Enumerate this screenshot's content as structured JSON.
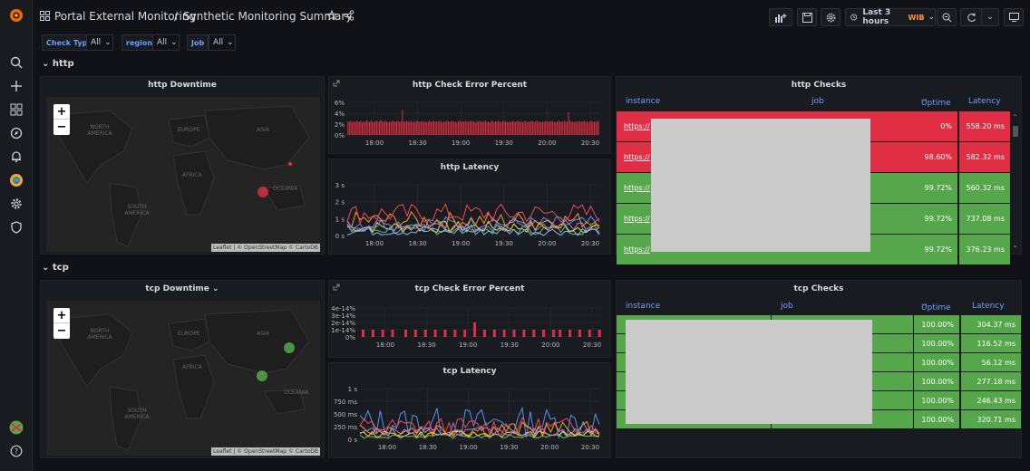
{
  "breadcrumb": {
    "folder": "Portal External Monitoring",
    "separator": "/",
    "dashboard": "Synthetic Monitoring Summary"
  },
  "time_picker": {
    "range": "Last 3 hours",
    "timezone": "WIB"
  },
  "variables": [
    {
      "label": "Check Type",
      "value": "All"
    },
    {
      "label": "region",
      "value": "All"
    },
    {
      "label": "Job",
      "value": "All"
    }
  ],
  "rows": {
    "http": "http",
    "tcp": "tcp"
  },
  "map_labels": {
    "north_america": "NORTH AMERICA",
    "south_america": "SOUTH AMERICA",
    "europe": "EUROPE",
    "africa": "AFRICA",
    "asia": "ASIA",
    "oceania": "OCEANIA",
    "zoom_in": "+",
    "zoom_out": "−",
    "attribution": "Leaflet | © OpenStreetMap © CartoDB"
  },
  "panels": {
    "http_downtime": {
      "title": "http Downtime"
    },
    "http_error": {
      "title": "http Check Error Percent"
    },
    "http_latency": {
      "title": "http Latency"
    },
    "http_checks": {
      "title": "http Checks"
    },
    "tcp_downtime": {
      "title": "tcp Downtime"
    },
    "tcp_error": {
      "title": "tcp Check Error Percent"
    },
    "tcp_latency": {
      "title": "tcp Latency"
    },
    "tcp_checks": {
      "title": "tcp Checks"
    }
  },
  "http_table": {
    "columns": [
      "instance",
      "job",
      "Uptime",
      "Latency"
    ],
    "rows": [
      {
        "instance": "https://",
        "uptime": "0%",
        "latency": "558.20 ms",
        "status": "down"
      },
      {
        "instance": "https://",
        "uptime": "98.60%",
        "latency": "582.32 ms",
        "status": "down"
      },
      {
        "instance": "https://",
        "uptime": "99.72%",
        "latency": "560.32 ms",
        "status": "up"
      },
      {
        "instance": "https://",
        "uptime": "99.72%",
        "latency": "737.08 ms",
        "status": "up"
      },
      {
        "instance": "https://",
        "uptime": "99.72%",
        "latency": "376.23 ms",
        "status": "up"
      }
    ]
  },
  "tcp_table": {
    "columns": [
      "instance",
      "job",
      "Uptime",
      "Latency"
    ],
    "rows": [
      {
        "uptime": "100.00%",
        "latency": "304.37 ms"
      },
      {
        "uptime": "100.00%",
        "latency": "116.52 ms"
      },
      {
        "uptime": "100.00%",
        "latency": "56.12 ms"
      },
      {
        "uptime": "100.00%",
        "latency": "277.18 ms"
      },
      {
        "uptime": "100.00%",
        "latency": "246.43 ms"
      },
      {
        "uptime": "100.00%",
        "latency": "320.71 ms"
      }
    ]
  },
  "colors": {
    "red": "#e02f44",
    "green": "#56a64b",
    "bg": "#111217",
    "panel": "#181b1f",
    "blue": "#6e9fff"
  },
  "chart_data": [
    {
      "type": "bar",
      "title": "http Check Error Percent",
      "y_ticks": [
        "6%",
        "4%",
        "2%",
        "0%"
      ],
      "ylim": [
        0,
        6
      ],
      "x_ticks": [
        "18:00",
        "18:30",
        "19:00",
        "19:30",
        "20:00",
        "20:30"
      ],
      "values": [
        2.5,
        2.4,
        2.6,
        2.3,
        2.5,
        2.4,
        2.6,
        2.5,
        2.4,
        2.6,
        2.3,
        2.5,
        2.4,
        2.7,
        2.5,
        2.4,
        2.6,
        2.5,
        2.3,
        2.5,
        2.6,
        2.4,
        2.5,
        2.8,
        2.5,
        2.4,
        2.6,
        2.5,
        2.3,
        2.5,
        2.4,
        2.6,
        2.5,
        2.4,
        2.5,
        2.6,
        2.4,
        2.5,
        4.6,
        2.5,
        2.4,
        2.6,
        2.5,
        2.4,
        2.6,
        2.3,
        2.5,
        2.4,
        2.6,
        2.5,
        2.4,
        2.5,
        2.6,
        2.4,
        2.5,
        2.3,
        2.5,
        2.6,
        2.4,
        2.5,
        2.6,
        2.4,
        2.5,
        2.4,
        2.6,
        2.5,
        2.3,
        2.5,
        2.4,
        2.6,
        2.5,
        2.4,
        2.5,
        2.6,
        2.4,
        2.5,
        2.3,
        2.5,
        2.6,
        2.4,
        2.5,
        2.4,
        2.6,
        2.5,
        2.4,
        2.5,
        2.6,
        2.4,
        2.5,
        2.3,
        2.5,
        2.4,
        2.6,
        2.5,
        2.4,
        2.5,
        2.6,
        2.4,
        2.5,
        2.3,
        2.5,
        2.6,
        2.4,
        2.5,
        2.4,
        2.6,
        2.5,
        2.4,
        2.5,
        2.6,
        2.4,
        2.5,
        2.3,
        2.5,
        2.4,
        2.6,
        2.5,
        2.4,
        2.5,
        2.6,
        2.4,
        2.5,
        2.3,
        2.5,
        2.6,
        2.4,
        2.5,
        2.4,
        2.6,
        2.5,
        2.4,
        2.5,
        2.6,
        2.4,
        2.5,
        2.3,
        2.5,
        2.4,
        2.6,
        2.5,
        2.4,
        2.5,
        2.6,
        2.4,
        2.5,
        2.3,
        2.5,
        2.6,
        2.4,
        2.5,
        2.4,
        2.6,
        2.5,
        2.4,
        4.2,
        2.6,
        2.4,
        2.5,
        2.3,
        2.5,
        2.4,
        2.6,
        2.5,
        2.4,
        2.5,
        2.6,
        2.4,
        2.5,
        2.3,
        2.5,
        2.6,
        2.4,
        2.5,
        2.4,
        2.6,
        2.5
      ]
    },
    {
      "type": "line",
      "title": "http Latency",
      "y_ticks": [
        "3 s",
        "2 s",
        "1 s",
        "0 s"
      ],
      "ylim": [
        0,
        3
      ],
      "x_ticks": [
        "18:00",
        "18:30",
        "19:00",
        "19:30",
        "20:00",
        "20:30"
      ],
      "series": [
        {
          "color": "#fade2a",
          "base": 0.5,
          "amp": 0.35
        },
        {
          "color": "#73bf69",
          "base": 0.35,
          "amp": 0.3
        },
        {
          "color": "#5794f2",
          "base": 0.7,
          "amp": 0.45
        },
        {
          "color": "#ff9830",
          "base": 0.9,
          "amp": 0.5
        },
        {
          "color": "#f2495c",
          "base": 1.3,
          "amp": 0.6
        },
        {
          "color": "#b877d9",
          "base": 0.6,
          "amp": 0.35
        },
        {
          "color": "#8ab8ff",
          "base": 0.25,
          "amp": 0.25
        }
      ]
    },
    {
      "type": "bar",
      "title": "tcp Check Error Percent",
      "y_ticks": [
        "4e-14%",
        "3e-14%",
        "2e-14%",
        "1e-14%",
        "0%"
      ],
      "ylim": [
        0,
        4
      ],
      "x_ticks": [
        "18:00",
        "18:30",
        "19:00",
        "19:30",
        "20:00",
        "20:30"
      ],
      "values": [
        0,
        1,
        0,
        0,
        1,
        0,
        0,
        1,
        0,
        0,
        1,
        0,
        0,
        0,
        1,
        0,
        0,
        1,
        0,
        0,
        1,
        0,
        0,
        1,
        0,
        0,
        1,
        0,
        0,
        1,
        0,
        0,
        1,
        0,
        0,
        2,
        0,
        0,
        1,
        0,
        0,
        1,
        0,
        0,
        1,
        0,
        0,
        1,
        0,
        0,
        1,
        0,
        0,
        1,
        0,
        0,
        1,
        0,
        0,
        1,
        0,
        1,
        0,
        0,
        1,
        0,
        0,
        1,
        0,
        0,
        1,
        0,
        0,
        1
      ]
    },
    {
      "type": "line",
      "title": "tcp Latency",
      "y_ticks": [
        "1 s",
        "750 ms",
        "500 ms",
        "250 ms",
        "0 s"
      ],
      "ylim": [
        0,
        1000
      ],
      "x_ticks": [
        "18:00",
        "18:30",
        "19:00",
        "19:30",
        "20:00",
        "20:30"
      ],
      "series": [
        {
          "color": "#5794f2",
          "base": 330,
          "amp": 300
        },
        {
          "color": "#f2495c",
          "base": 250,
          "amp": 180
        },
        {
          "color": "#ff9830",
          "base": 200,
          "amp": 150
        },
        {
          "color": "#fade2a",
          "base": 100,
          "amp": 60
        },
        {
          "color": "#73bf69",
          "base": 60,
          "amp": 40
        },
        {
          "color": "#b877d9",
          "base": 150,
          "amp": 80
        }
      ]
    }
  ]
}
